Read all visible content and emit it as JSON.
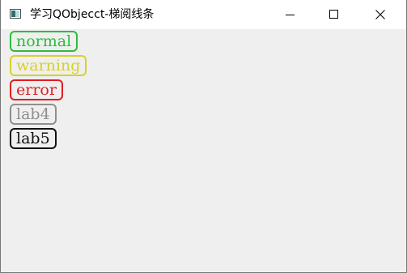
{
  "window": {
    "title": "学习QObjecct-梯阅线条",
    "icon": "app-window-icon",
    "controls": [
      "minimize-icon",
      "maximize-icon",
      "close-icon"
    ]
  },
  "labels": [
    {
      "text": "normal",
      "color": "#2bbd3a"
    },
    {
      "text": "warning",
      "color": "#d8d02a"
    },
    {
      "text": "error",
      "color": "#e01f1f"
    },
    {
      "text": "lab4",
      "color": "#8f8f8f"
    },
    {
      "text": "lab5",
      "color": "#111111"
    }
  ]
}
